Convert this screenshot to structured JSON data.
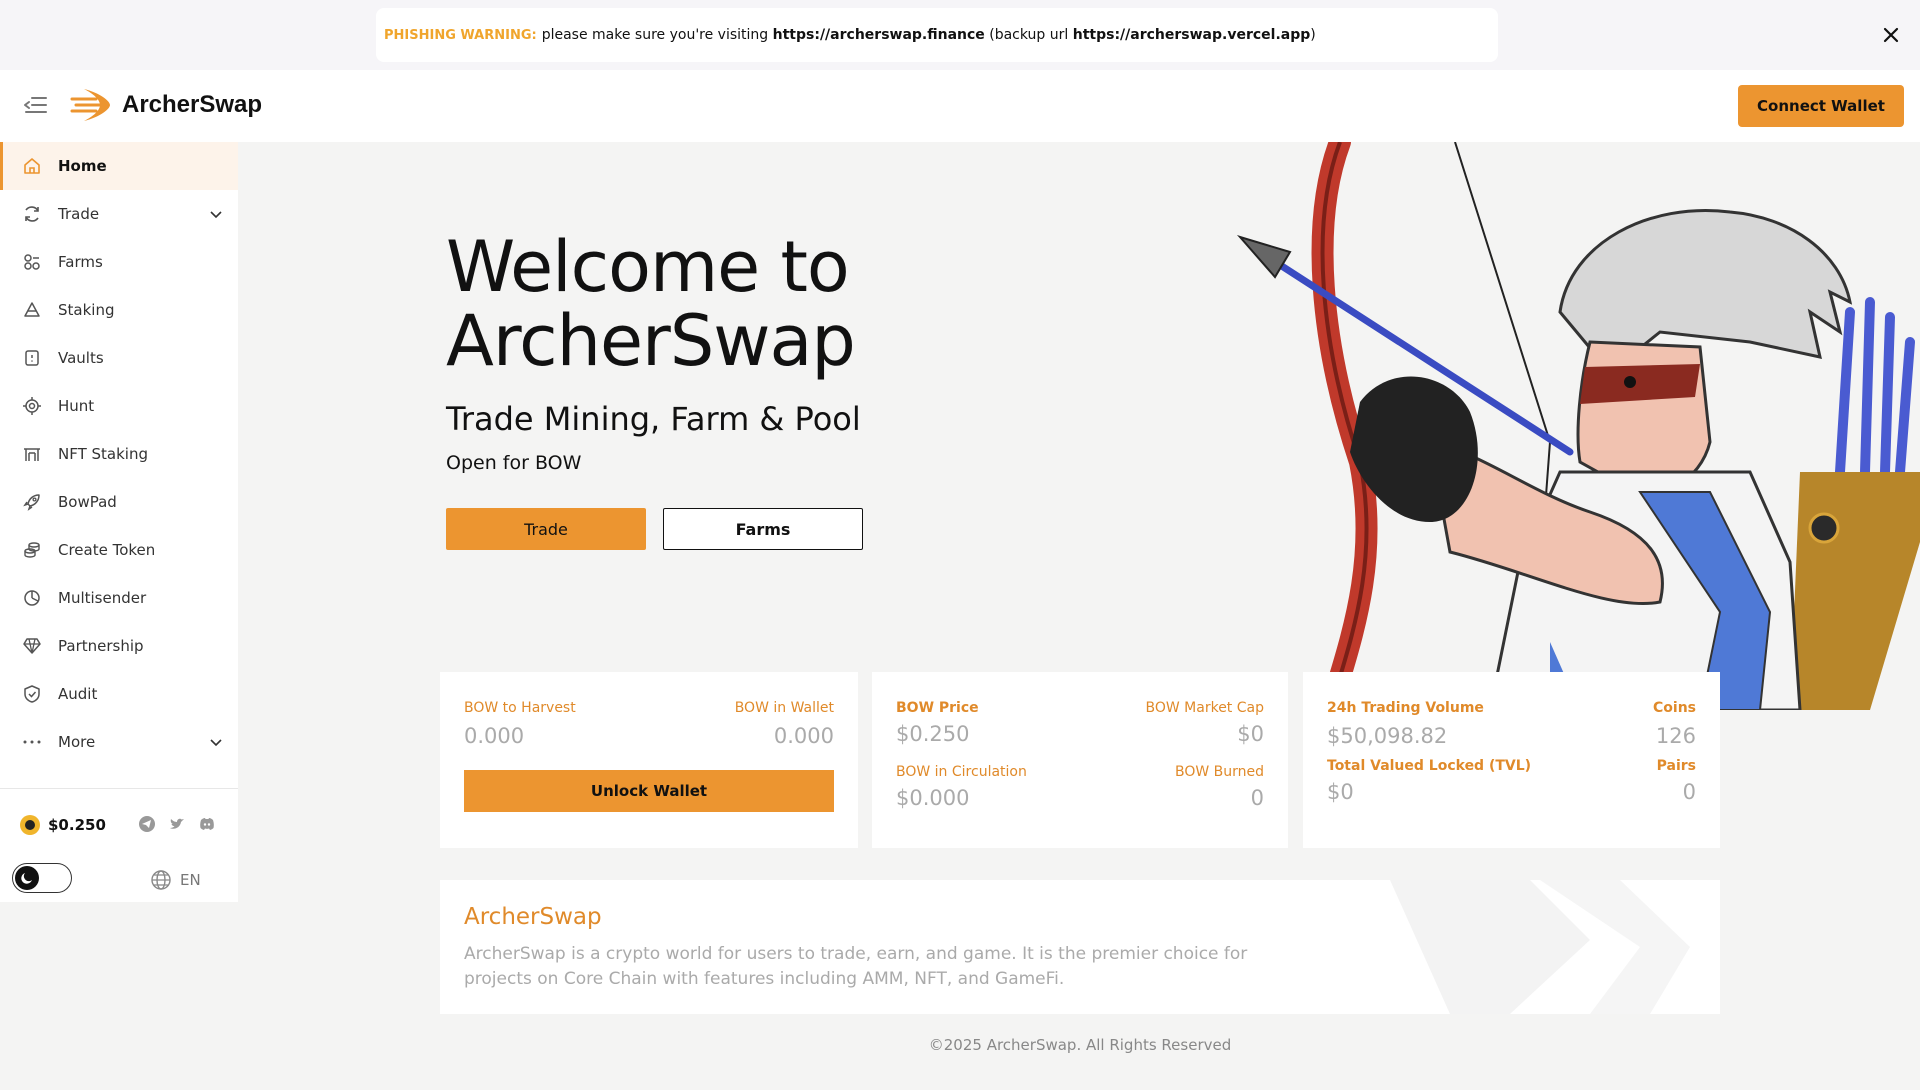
{
  "banner": {
    "warning_label": "PHISHING WARNING:",
    "text_before": "please make sure you're visiting",
    "primary_url": "https://archerswap.finance",
    "backup_prefix": "(backup url",
    "backup_url": "https://archerswap.vercel.app",
    "backup_suffix": ")"
  },
  "header": {
    "brand": "ArcherSwap",
    "connect_label": "Connect Wallet"
  },
  "sidebar": {
    "items": [
      {
        "label": "Home",
        "icon": "home-icon"
      },
      {
        "label": "Trade",
        "icon": "refresh-icon"
      },
      {
        "label": "Farms",
        "icon": "farms-icon"
      },
      {
        "label": "Staking",
        "icon": "staking-icon"
      },
      {
        "label": "Vaults",
        "icon": "vault-icon"
      },
      {
        "label": "Hunt",
        "icon": "target-icon"
      },
      {
        "label": "NFT Staking",
        "icon": "nft-icon"
      },
      {
        "label": "BowPad",
        "icon": "rocket-icon"
      },
      {
        "label": "Create Token",
        "icon": "coins-icon"
      },
      {
        "label": "Multisender",
        "icon": "pie-icon"
      },
      {
        "label": "Partnership",
        "icon": "diamond-icon"
      },
      {
        "label": "Audit",
        "icon": "shield-check-icon"
      },
      {
        "label": "More",
        "icon": "dots-icon"
      }
    ],
    "price": "$0.250",
    "language": "EN"
  },
  "hero": {
    "title_line1": "Welcome to",
    "title_line2": "ArcherSwap",
    "subtitle": "Trade Mining, Farm & Pool",
    "tagline": "Open for BOW",
    "trade_label": "Trade",
    "farms_label": "Farms"
  },
  "cards": {
    "harvest": {
      "harvest_label": "BOW to Harvest",
      "harvest_value": "0.000",
      "wallet_label": "BOW in Wallet",
      "wallet_value": "0.000",
      "unlock_label": "Unlock Wallet"
    },
    "price": {
      "price_label": "BOW Price",
      "price_value": "$0.250",
      "mcap_label": "BOW Market Cap",
      "mcap_value": "$0",
      "circ_label": "BOW in Circulation",
      "circ_value": "$0.000",
      "burned_label": "BOW Burned",
      "burned_value": "0"
    },
    "volume": {
      "volume_label": "24h Trading Volume",
      "volume_value": "$50,098.82",
      "coins_label": "Coins",
      "coins_value": "126",
      "tvl_label": "Total Valued Locked (TVL)",
      "tvl_value": "$0",
      "pairs_label": "Pairs",
      "pairs_value": "0"
    }
  },
  "about": {
    "title": "ArcherSwap",
    "text": "ArcherSwap is a crypto world for users to trade, earn, and game. It is the premier choice for projects on Core Chain with features including AMM, NFT, and GameFi."
  },
  "footer": {
    "copyright": "©2025 ArcherSwap. All Rights Reserved"
  },
  "colors": {
    "accent": "#ec9530",
    "label_orange": "#e08a2a",
    "background": "#f4f4f3"
  }
}
